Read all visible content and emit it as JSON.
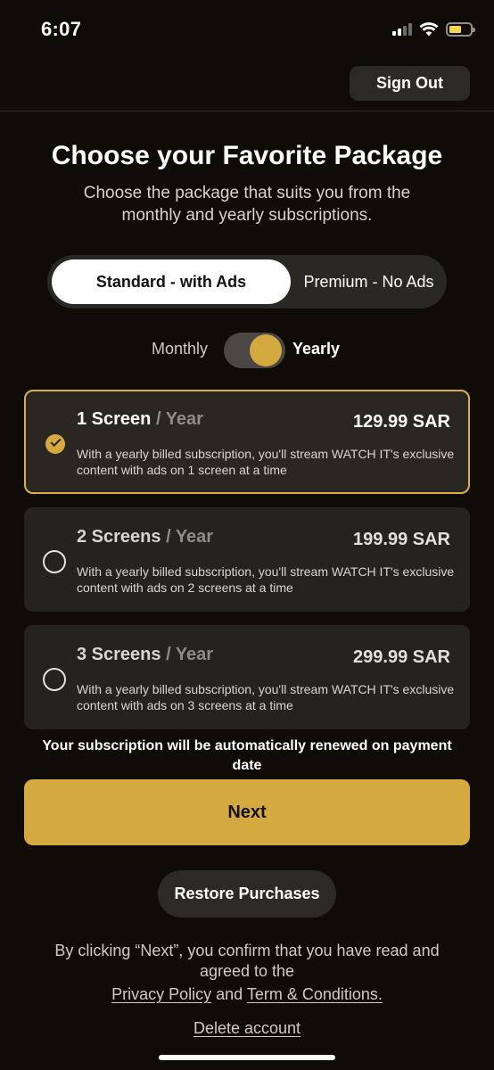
{
  "status_bar": {
    "time": "6:07",
    "signal_icon": "cellular-signal-icon",
    "wifi_icon": "wifi-icon",
    "battery_icon": "battery-icon",
    "battery_color": "#f6d64a"
  },
  "header": {
    "sign_out_label": "Sign Out"
  },
  "intro": {
    "title": "Choose your Favorite Package",
    "subtitle": "Choose the package that suits you from the monthly and yearly subscriptions."
  },
  "package_tabs": {
    "options": [
      "Standard - with Ads",
      "Premium - No Ads"
    ],
    "selected": "Standard - with Ads"
  },
  "billing": {
    "monthly_label": "Monthly",
    "yearly_label": "Yearly",
    "selected": "Yearly"
  },
  "plans": [
    {
      "count": "1 Screen",
      "period": " / Year",
      "price": "129.99 SAR",
      "description": "With a yearly billed subscription, you'll stream WATCH IT's exclusive content with ads on 1 screen at a time",
      "selected": true
    },
    {
      "count": "2 Screens",
      "period": " / Year",
      "price": "199.99 SAR",
      "description": "With a yearly billed subscription, you'll stream WATCH IT's exclusive content with ads on 2 screens at a time",
      "selected": false
    },
    {
      "count": "3 Screens",
      "period": " / Year",
      "price": "299.99 SAR",
      "description": "With a yearly billed subscription, you'll stream WATCH IT's exclusive content with ads on 3 screens at a time",
      "selected": false
    }
  ],
  "renew_note": "Your subscription will be automatically renewed on payment date",
  "next_label": "Next",
  "restore_label": "Restore Purchases",
  "legal": {
    "text": "By clicking “Next”, you confirm that you have read and agreed to the",
    "privacy_label": "Privacy Policy",
    "and_label": " and ",
    "terms_label": "Term & Conditions."
  },
  "delete_account_label": "Delete account",
  "colors": {
    "accent": "#d4a93f",
    "background": "#0f0c08",
    "card": "#25231f"
  }
}
